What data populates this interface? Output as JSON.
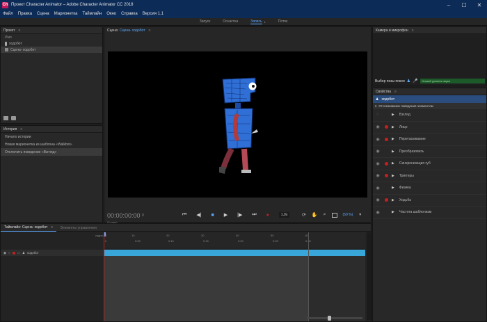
{
  "window": {
    "title": "Проект Character Animator – Adobe Character Animator CC 2018",
    "icon_text": "Ch"
  },
  "menu": [
    "Файл",
    "Правка",
    "Сцена",
    "Марионетка",
    "Таймлайн",
    "Окно",
    "Справка",
    "Версия 1.1"
  ],
  "workflow": {
    "items": [
      "Запуск",
      "Оснастка",
      "Запись",
      "Поток"
    ],
    "active": "Запись",
    "counter": "1"
  },
  "project": {
    "title": "Проект",
    "column": "Имя",
    "items": [
      "ходобот",
      "Сцена- ходобот"
    ]
  },
  "history": {
    "title": "История",
    "items": [
      "Начало истории",
      "Новая марионетка из шаблона «Walkbot»",
      "Отключить поведение «Взгляд»"
    ]
  },
  "scene": {
    "title": "Сцена:",
    "scene_name": "Сцена- ходобот",
    "timecode": "00:00:00:00",
    "frame": "0",
    "frame_info": "(0 кадр)",
    "speed": "1,0x",
    "zoom": "(50 %)"
  },
  "camera": {
    "title": "Камера и микрофон",
    "rest_pose": "Выбор позы покоя",
    "mic_status": "Низкий уровень звука"
  },
  "properties": {
    "title": "Свойства",
    "puppet": "ходобот",
    "section": "Отслеживание поведения элементом",
    "behaviors": [
      {
        "name": "Взгляд",
        "rec": false
      },
      {
        "name": "Лицо",
        "rec": true
      },
      {
        "name": "Перетаскивание",
        "rec": true
      },
      {
        "name": "Преобразовать",
        "rec": false
      },
      {
        "name": "Синхронизация губ",
        "rec": true
      },
      {
        "name": "Триггеры",
        "rec": true
      },
      {
        "name": "Физика",
        "rec": false
      },
      {
        "name": "Ходьба",
        "rec": true
      },
      {
        "name": "Частота шаблонизм",
        "rec": false
      }
    ]
  },
  "timeline": {
    "tab_active": "Таймлайн: Сцена- ходобот",
    "tab_inactive": "Элементы управления",
    "track_name": "ходобот",
    "ruler_labels": [
      "0",
      "0:05",
      "0:10",
      "0:15",
      "0:20",
      "0:25",
      "0:30"
    ],
    "ruler_labels_top": [
      "кадры",
      "0",
      "10",
      "20",
      "30",
      "40",
      "50",
      "60"
    ]
  },
  "colors": {
    "titlebar": "#0c2b57",
    "accent": "#5aa9ff",
    "track": "#38a6d8",
    "record": "#c42020"
  }
}
